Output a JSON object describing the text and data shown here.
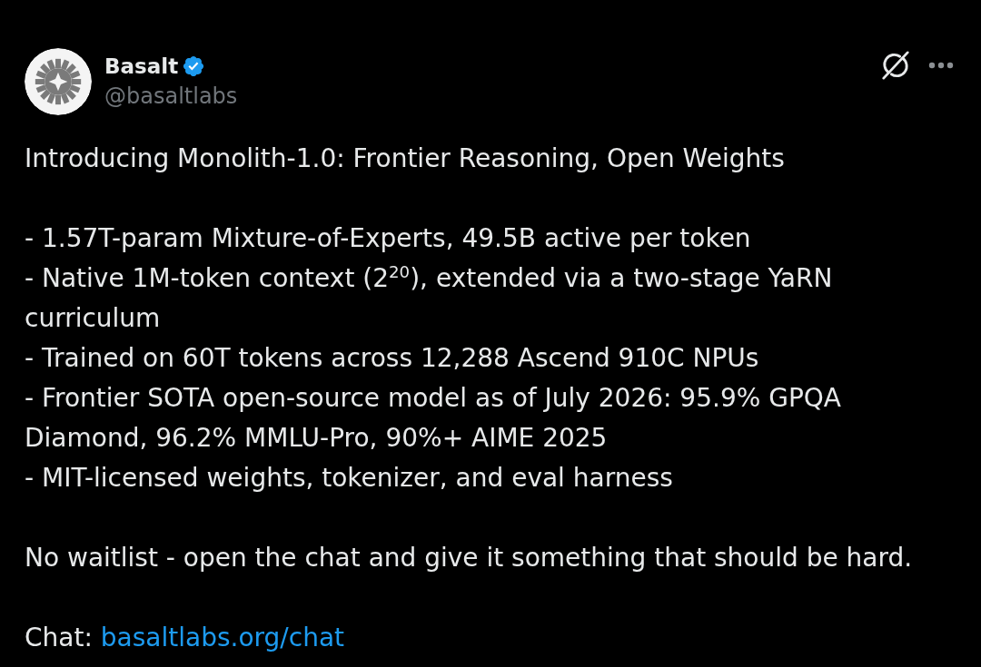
{
  "author": {
    "name": "Basalt",
    "verified": true,
    "handle": "@basaltlabs"
  },
  "post": {
    "title": "Introducing Monolith-1.0: Frontier Reasoning, Open Weights",
    "bullets": [
      "- 1.57T-param Mixture-of-Experts, 49.5B active per token",
      "- Native 1M-token context (2$^{20}$), extended via a two-stage YaRN curriculum",
      "- Trained on 60T tokens across 12,288 Ascend 910C NPUs",
      "- Frontier SOTA open-source model as of July 2026: 95.9% GPQA Diamond, 96.2% MMLU-Pro, 90%+ AIME 2025",
      "- MIT-licensed weights, tokenizer, and eval harness"
    ],
    "closing": "No waitlist - open the chat and give it something that should be hard.",
    "link_label": "Chat:",
    "link": "basaltlabs.org/chat"
  }
}
